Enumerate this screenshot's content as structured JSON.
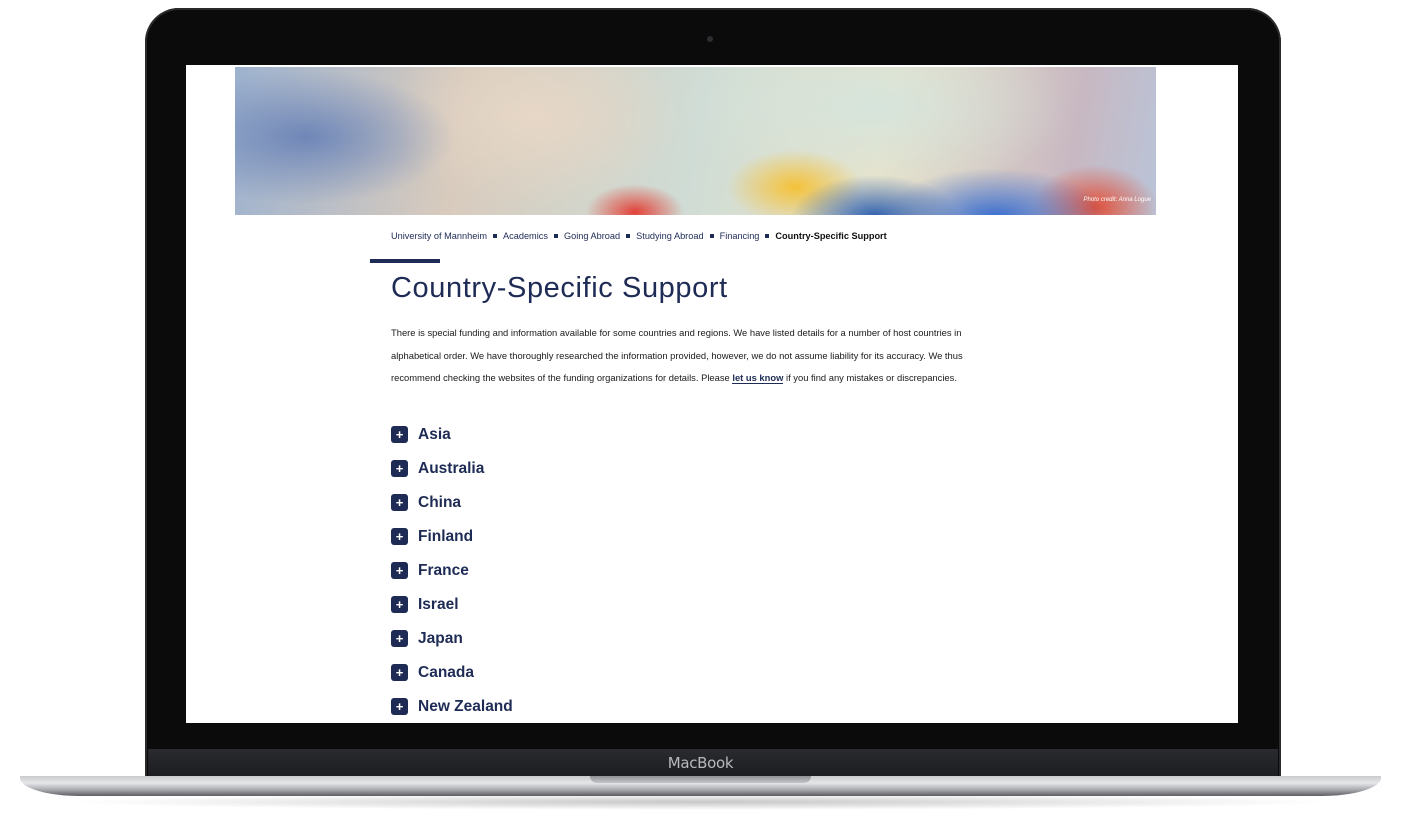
{
  "device": {
    "brand": "MacBook"
  },
  "hero": {
    "photo_credit": "Photo credit: Anna Logue"
  },
  "breadcrumb": {
    "items": [
      "University of Mannheim",
      "Academics",
      "Going Abroad",
      "Studying Abroad",
      "Financing"
    ],
    "current": "Country-Specific Support"
  },
  "page": {
    "title": "Country-Specific Support",
    "intro_before_link": "There is special funding and information available for some countries and regions. We have listed details for a number of host countries in alphabetical order. We have thoroughly researched the information provided, however, we do not assume liability for its accuracy. We thus recommend checking the websites of the funding organizations for details. Please ",
    "intro_link": "let us know",
    "intro_after_link": " if you find any mistakes or discrepancies."
  },
  "accordion": {
    "expand_icon": "+",
    "items": [
      "Asia",
      "Australia",
      "China",
      "Finland",
      "France",
      "Israel",
      "Japan",
      "Canada",
      "New Zealand"
    ]
  },
  "colors": {
    "brand_navy": "#1e2b55"
  }
}
